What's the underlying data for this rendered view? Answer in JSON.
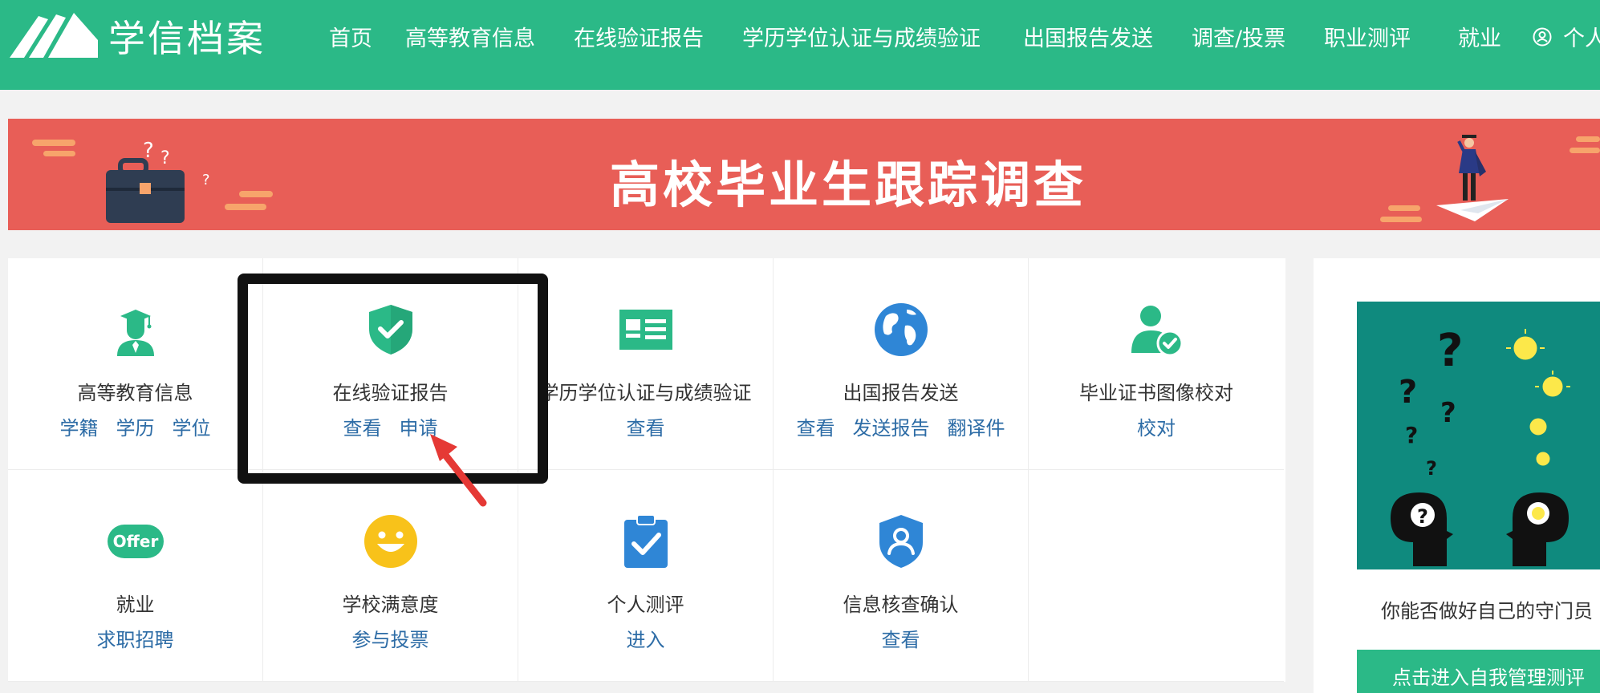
{
  "header": {
    "logo_text": "学信档案",
    "nav": [
      "首页",
      "高等教育信息",
      "在线验证报告",
      "学历学位认证与成绩验证",
      "出国报告发送",
      "调查/投票",
      "职业测评",
      "就业"
    ],
    "user_label": "个人",
    "background": "#2bb987"
  },
  "banner": {
    "title": "高校毕业生跟踪调查",
    "background": "#e85e57"
  },
  "services": [
    {
      "title": "高等教育信息",
      "icon": "graduate-icon",
      "links": [
        "学籍",
        "学历",
        "学位"
      ]
    },
    {
      "title": "在线验证报告",
      "icon": "shield-check-icon",
      "links": [
        "查看",
        "申请"
      ]
    },
    {
      "title": "学历学位认证与成绩验证",
      "icon": "id-card-icon",
      "links": [
        "查看"
      ]
    },
    {
      "title": "出国报告发送",
      "icon": "globe-icon",
      "links": [
        "查看",
        "发送报告",
        "翻译件"
      ]
    },
    {
      "title": "毕业证书图像校对",
      "icon": "user-check-icon",
      "links": [
        "校对"
      ]
    },
    {
      "title": "就业",
      "icon": "offer-icon",
      "icon_text": "Offer",
      "links": [
        "求职招聘"
      ]
    },
    {
      "title": "学校满意度",
      "icon": "smiley-icon",
      "links": [
        "参与投票"
      ]
    },
    {
      "title": "个人测评",
      "icon": "clipboard-check-icon",
      "links": [
        "进入"
      ]
    },
    {
      "title": "信息核查确认",
      "icon": "shield-user-icon",
      "links": [
        "查看"
      ]
    }
  ],
  "side": {
    "caption": "你能否做好自己的守门员",
    "button": "点击进入自我管理测评"
  },
  "colors": {
    "link": "#2d6ca6",
    "green": "#2bb987",
    "highlight_box": "#111111",
    "arrow": "#e53935"
  }
}
